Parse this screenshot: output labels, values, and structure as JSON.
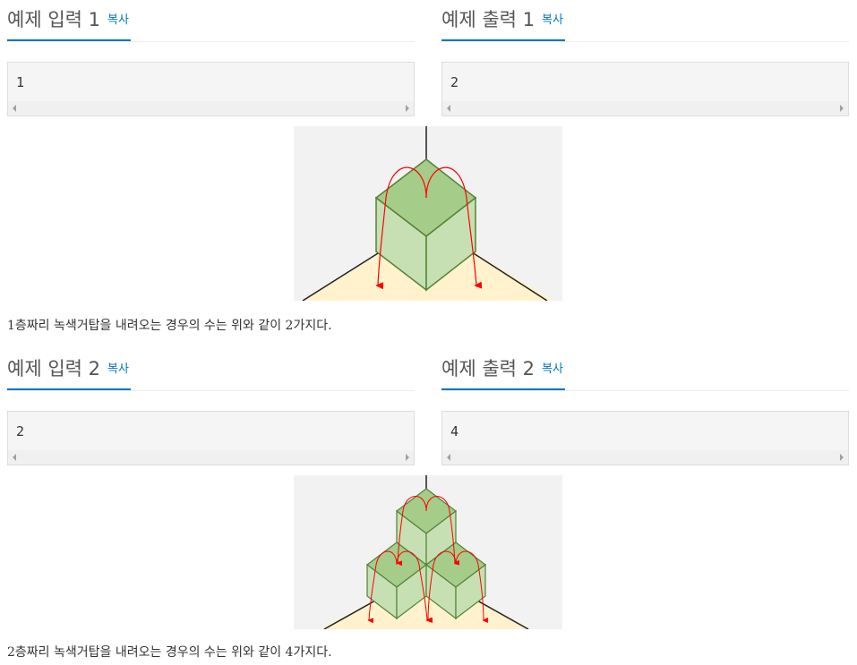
{
  "examples": [
    {
      "input_title": "예제 입력 1",
      "output_title": "예제 출력 1",
      "copy_label": "복사",
      "input_value": "1",
      "output_value": "2",
      "caption": "1층짜리 녹색거탑을 내려오는 경우의 수는 위와 같이 2가지다."
    },
    {
      "input_title": "예제 입력 2",
      "output_title": "예제 출력 2",
      "copy_label": "복사",
      "input_value": "2",
      "output_value": "4",
      "caption": "2층짜리 녹색거탑을 내려오는 경우의 수는 위와 같이 4가지다."
    }
  ],
  "colors": {
    "accent": "#0076c0",
    "cube_top": "#a6cc8a",
    "cube_side": "#c6e0b4",
    "cube_edge": "#548235",
    "floor": "#fff2cc",
    "arrow": "#ff0000"
  }
}
